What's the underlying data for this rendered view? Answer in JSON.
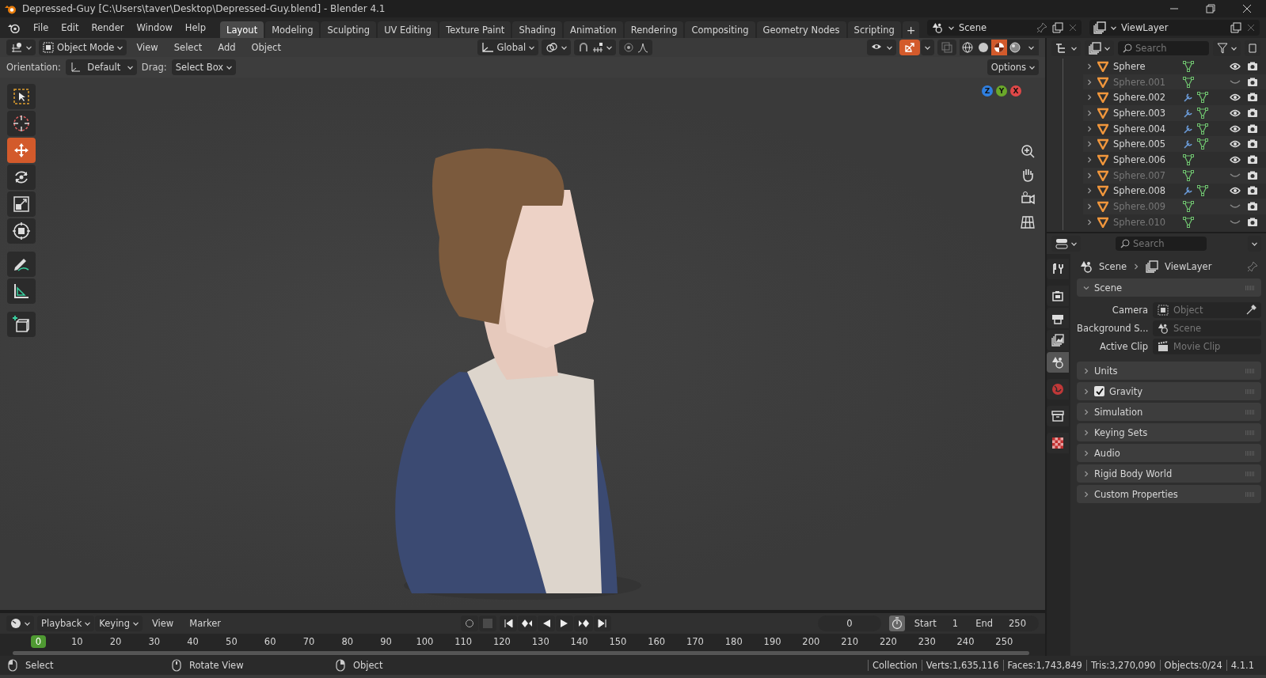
{
  "window": {
    "title": "Depressed-Guy [C:\\Users\\taver\\Desktop\\Depressed-Guy.blend] - Blender 4.1"
  },
  "menu": [
    "File",
    "Edit",
    "Render",
    "Window",
    "Help"
  ],
  "workspaces": [
    {
      "label": "Layout",
      "selected": true
    },
    {
      "label": "Modeling",
      "selected": false
    },
    {
      "label": "Sculpting",
      "selected": false
    },
    {
      "label": "UV Editing",
      "selected": false
    },
    {
      "label": "Texture Paint",
      "selected": false
    },
    {
      "label": "Shading",
      "selected": false
    },
    {
      "label": "Animation",
      "selected": false
    },
    {
      "label": "Rendering",
      "selected": false
    },
    {
      "label": "Compositing",
      "selected": false
    },
    {
      "label": "Geometry Nodes",
      "selected": false
    },
    {
      "label": "Scripting",
      "selected": false
    }
  ],
  "add_workspace": "+",
  "scene_selector": {
    "value": "Scene"
  },
  "view_layer_selector": {
    "value": "ViewLayer"
  },
  "viewport_header": {
    "mode": "Object Mode",
    "menus": [
      "View",
      "Select",
      "Add",
      "Object"
    ],
    "orientation": "Global",
    "toggles": [
      {
        "kind": "gizmo",
        "on": true
      },
      {
        "kind": "xray",
        "on": false
      }
    ],
    "shading_modes": [
      {
        "kind": "wireframe",
        "selected": false
      },
      {
        "kind": "solid",
        "selected": false
      },
      {
        "kind": "material",
        "selected": true
      },
      {
        "kind": "rendered",
        "selected": false
      }
    ]
  },
  "tool_settings": {
    "orientation_label": "Orientation:",
    "orientation": "Default",
    "drag_label": "Drag:",
    "drag": "Select Box",
    "options": "Options"
  },
  "tools": [
    {
      "kind": "select",
      "selected": false
    },
    {
      "kind": "cursor",
      "selected": false
    },
    {
      "kind": "move",
      "selected": true
    },
    {
      "kind": "rotate",
      "selected": false
    },
    {
      "kind": "scale",
      "selected": false
    },
    {
      "kind": "transform",
      "selected": false
    },
    {
      "kind": "annotate",
      "selected": false
    },
    {
      "kind": "measure",
      "selected": false
    },
    {
      "kind": "add-cube",
      "selected": false
    }
  ],
  "axes": [
    "Z",
    "Y",
    "X"
  ],
  "outliner": {
    "search": {
      "placeholder": "Search"
    },
    "rows": [
      {
        "name": "Sphere",
        "visible": true,
        "modifier": false
      },
      {
        "name": "Sphere.001",
        "visible": false,
        "modifier": false
      },
      {
        "name": "Sphere.002",
        "visible": true,
        "modifier": true
      },
      {
        "name": "Sphere.003",
        "visible": true,
        "modifier": true
      },
      {
        "name": "Sphere.004",
        "visible": true,
        "modifier": true
      },
      {
        "name": "Sphere.005",
        "visible": true,
        "modifier": true
      },
      {
        "name": "Sphere.006",
        "visible": true,
        "modifier": false
      },
      {
        "name": "Sphere.007",
        "visible": false,
        "modifier": false
      },
      {
        "name": "Sphere.008",
        "visible": true,
        "modifier": true
      },
      {
        "name": "Sphere.009",
        "visible": false,
        "modifier": false
      },
      {
        "name": "Sphere.010",
        "visible": false,
        "modifier": false
      }
    ]
  },
  "properties": {
    "search": {
      "placeholder": "Search"
    },
    "tabs": [
      {
        "kind": "tool",
        "selected": false
      },
      {
        "kind": "render",
        "selected": false
      },
      {
        "kind": "output",
        "selected": false
      },
      {
        "kind": "view-layer",
        "selected": false
      },
      {
        "kind": "scene",
        "selected": true
      },
      {
        "kind": "world",
        "selected": false
      },
      {
        "kind": "collection",
        "selected": false
      },
      {
        "kind": "texture",
        "selected": false
      }
    ],
    "breadcrumb": [
      "Scene",
      "ViewLayer"
    ],
    "panels": [
      {
        "title": "Scene",
        "kind": "plain",
        "expanded": true,
        "fields": [
          {
            "label": "Camera",
            "placeholder": "Object"
          },
          {
            "label": "Background S...",
            "placeholder": "Scene"
          },
          {
            "label": "Active Clip",
            "placeholder": "Movie Clip"
          }
        ]
      },
      {
        "title": "Units",
        "kind": "plain",
        "expanded": false
      },
      {
        "title": "Gravity",
        "kind": "checkbox",
        "checked": true,
        "expanded": false
      },
      {
        "title": "Simulation",
        "kind": "plain",
        "expanded": false
      },
      {
        "title": "Keying Sets",
        "kind": "plain",
        "expanded": false
      },
      {
        "title": "Audio",
        "kind": "plain",
        "expanded": false
      },
      {
        "title": "Rigid Body World",
        "kind": "plain",
        "expanded": false
      },
      {
        "title": "Custom Properties",
        "kind": "plain",
        "expanded": false
      }
    ]
  },
  "timeline": {
    "menus": [
      "Playback",
      "Keying"
    ],
    "links": [
      "View",
      "Marker"
    ],
    "current_frame": "0",
    "start_label": "Start",
    "start": "1",
    "end_label": "End",
    "end": "250",
    "playhead": "0",
    "ticks": [
      "10",
      "20",
      "30",
      "40",
      "50",
      "60",
      "70",
      "80",
      "90",
      "100",
      "110",
      "120",
      "130",
      "140",
      "150",
      "160",
      "170",
      "180",
      "190",
      "200",
      "210",
      "220",
      "230",
      "240",
      "250"
    ]
  },
  "status_bar": {
    "hints": [
      {
        "kind": "left",
        "text": "Select"
      },
      {
        "kind": "middle",
        "text": "Rotate View"
      },
      {
        "kind": "right",
        "text": "Object"
      }
    ],
    "stats": [
      "Collection",
      "Verts:1,635,116",
      "Faces:1,743,849",
      "Tris:3,270,090",
      "Objects:0/24",
      "4.1.1"
    ]
  }
}
